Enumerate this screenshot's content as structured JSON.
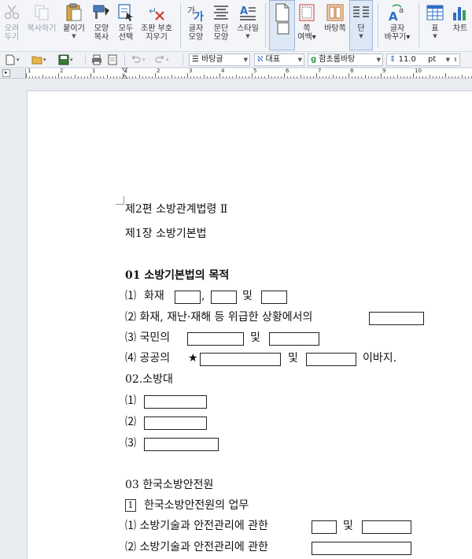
{
  "ribbon": {
    "buttons": [
      {
        "id": "cut",
        "label": "오려\n두기",
        "icon": "scissors-icon",
        "disabled": true
      },
      {
        "id": "copy",
        "label": "복사하기",
        "icon": "copy-icon",
        "disabled": true
      },
      {
        "id": "paste",
        "label": "붙이기",
        "icon": "clipboard-icon",
        "disabled": false
      },
      {
        "id": "format_copy",
        "label": "모양\n복사",
        "icon": "format-brush-icon",
        "disabled": false
      },
      {
        "id": "select_all",
        "label": "모두\n선택",
        "icon": "select-all-icon",
        "disabled": false
      },
      {
        "id": "clear_format",
        "label": "조판 부호\n지우기",
        "icon": "clear-format-icon",
        "disabled": false
      },
      {
        "id": "char_shape",
        "label": "글자\n모양",
        "icon": "char-shape-icon",
        "disabled": false
      },
      {
        "id": "para_shape",
        "label": "문단\n모양",
        "icon": "paragraph-shape-icon",
        "disabled": false
      },
      {
        "id": "style",
        "label": "스타일",
        "icon": "style-icon",
        "disabled": false
      },
      {
        "id": "page_margin",
        "label": "쪽\n여백",
        "icon": "page-margin-icon",
        "disabled": false
      },
      {
        "id": "page_border",
        "label": "",
        "icon": "page-border-icon",
        "disabled": false
      },
      {
        "id": "background_page",
        "label": "바탕쪽",
        "icon": "background-page-icon",
        "disabled": false
      },
      {
        "id": "columns",
        "label": "단",
        "icon": "columns-icon",
        "disabled": false
      },
      {
        "id": "char_replace",
        "label": "글자\n바꾸기",
        "icon": "char-replace-icon",
        "disabled": false
      },
      {
        "id": "table",
        "label": "표",
        "icon": "table-icon",
        "disabled": false
      },
      {
        "id": "chart",
        "label": "차트",
        "icon": "chart-icon",
        "disabled": false
      }
    ]
  },
  "toolbar": {
    "style_combo": "바탕글",
    "lang_combo": "대표",
    "font_combo": "함초롬바탕",
    "size_value": "11.0",
    "size_unit": "pt"
  },
  "ruler": {
    "numbers": [
      "1",
      "2",
      "1",
      "1",
      "2",
      "3",
      "4",
      "5",
      "6",
      "7",
      "8",
      "9",
      "10"
    ]
  },
  "document": {
    "line1": "제2편 소방관계법령 Ⅱ",
    "line2": "제1장 소방기본법",
    "h1": "01 소방기본법의 목적",
    "l1_num": "⑴",
    "l1_a": "화재",
    "l1_comma": ",",
    "l1_and": "및",
    "l2": "⑵ 화재, 재난·재해 등 위급한 상황에서의",
    "l3": "⑶ 국민의",
    "l3_and": "및",
    "l4": "⑷ 공공의",
    "l4_star": "★",
    "l4_and": "및",
    "l4_end": "이바지.",
    "h2": "02.소방대",
    "s1": "⑴",
    "s2": "⑵",
    "s3": "⑶",
    "h3": "03 한국소방안전원",
    "b1_box": "1",
    "b1_text": "한국소방안전원의 업무",
    "k1": "⑴ 소방기술과 안전관리에 관한",
    "k1_and": "및",
    "k2": "⑵ 소방기술과 안전관리에 관한"
  }
}
